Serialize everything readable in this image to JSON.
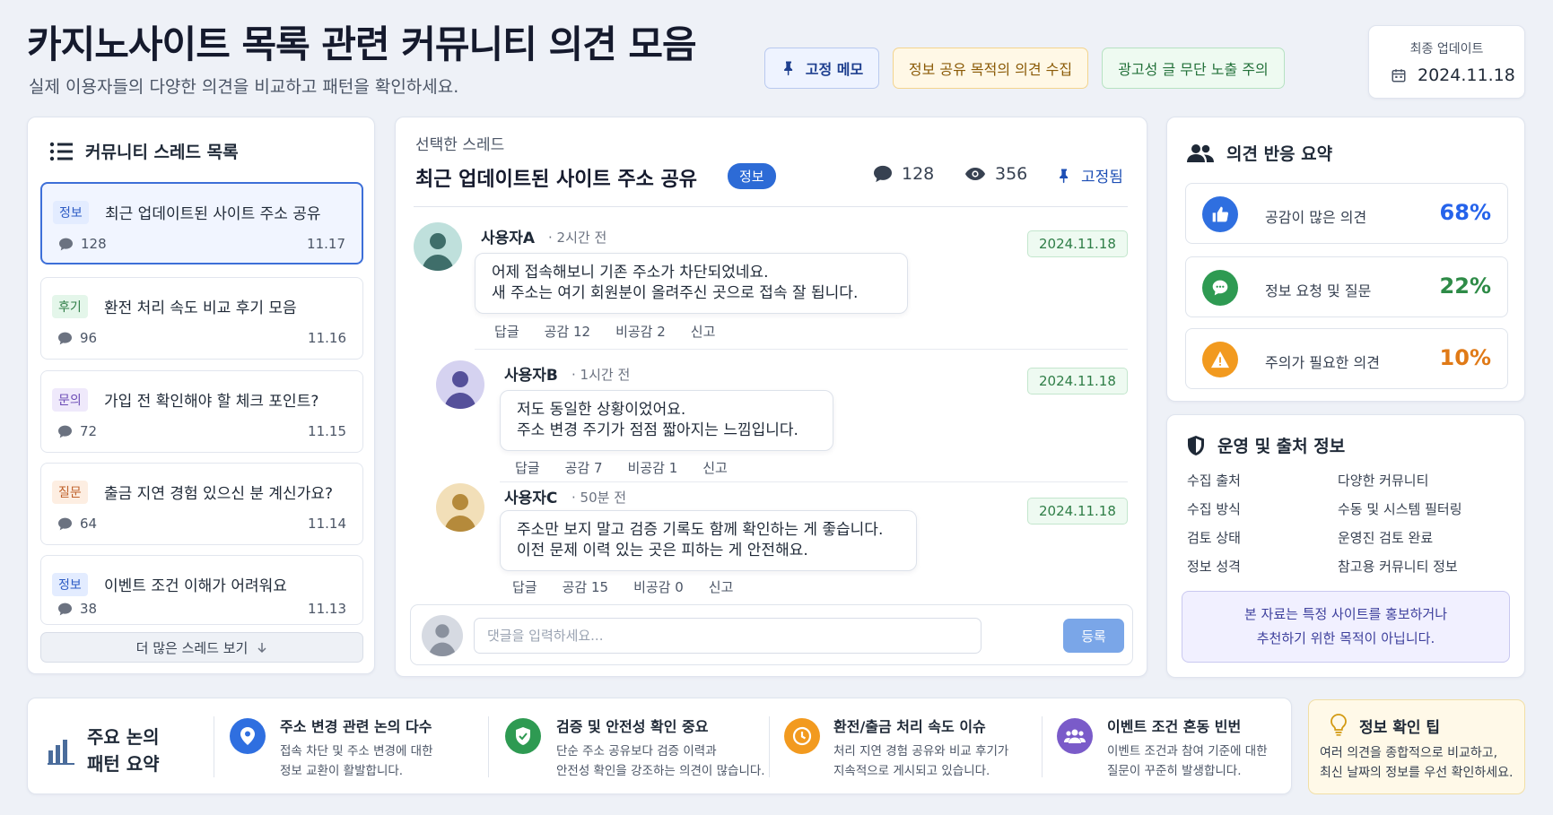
{
  "header": {
    "title": "카지노사이트 목록 관련 커뮤니티 의견 모음",
    "subtitle": "실제 이용자들의 다양한 의견을 비교하고 패턴을 확인하세요.",
    "chips": {
      "pinned_memo": "고정 메모",
      "info_collect": "정보 공유 목적의 의견 수집",
      "ad_warning": "광고성 글 무단 노출 주의"
    },
    "last_update_label": "최종 업데이트",
    "last_update_date": "2024.11.18"
  },
  "threads": {
    "heading": "커뮤니티 스레드 목록",
    "items": [
      {
        "tag": "정보",
        "title": "최근 업데이트된 사이트 주소 공유",
        "count": "128",
        "date": "11.17"
      },
      {
        "tag": "후기",
        "title": "환전 처리 속도 비교 후기 모음",
        "count": "96",
        "date": "11.16"
      },
      {
        "tag": "문의",
        "title": "가입 전 확인해야 할 체크 포인트?",
        "count": "72",
        "date": "11.15"
      },
      {
        "tag": "질문",
        "title": "출금 지연 경험 있으신 분 계신가요?",
        "count": "64",
        "date": "11.14"
      },
      {
        "tag": "정보",
        "title": "이벤트 조건 이해가 어려워요",
        "count": "38",
        "date": "11.13"
      }
    ],
    "more_label": "더 많은 스레드 보기"
  },
  "selected": {
    "label": "선택한 스레드",
    "title": "최근 업데이트된 사이트 주소 공유",
    "badge": "정보",
    "comments_count": "128",
    "views_count": "356",
    "pinned_label": "고정됨"
  },
  "comments": [
    {
      "author": "사용자A",
      "time": "· 2시간 전",
      "date": "2024.11.18",
      "line1": "어제 접속해보니 기존 주소가 차단되었네요.",
      "line2": "새 주소는 여기 회원분이 올려주신 곳으로 접속 잘 됩니다.",
      "reply": "답글",
      "like": "공감 12",
      "dislike": "비공감 2",
      "report": "신고"
    },
    {
      "author": "사용자B",
      "time": "· 1시간 전",
      "date": "2024.11.18",
      "line1": "저도 동일한 상황이었어요.",
      "line2": "주소 변경 주기가 점점 짧아지는 느낌입니다.",
      "reply": "답글",
      "like": "공감 7",
      "dislike": "비공감 1",
      "report": "신고"
    },
    {
      "author": "사용자C",
      "time": "· 50분 전",
      "date": "2024.11.18",
      "line1": "주소만 보지 말고 검증 기록도 함께 확인하는 게 좋습니다.",
      "line2": "이전 문제 이력 있는 곳은 피하는 게 안전해요.",
      "reply": "답글",
      "like": "공감 15",
      "dislike": "비공감 0",
      "report": "신고"
    }
  ],
  "comment_input": {
    "placeholder": "댓글을 입력하세요...",
    "submit_label": "등록"
  },
  "summary": {
    "heading": "의견 반응 요약",
    "items": [
      {
        "label": "공감이 많은 의견",
        "value": "68%",
        "color": "#2563eb"
      },
      {
        "label": "정보 요청 및 질문",
        "value": "22%",
        "color": "#2e8b47"
      },
      {
        "label": "주의가 필요한 의견",
        "value": "10%",
        "color": "#e07a17"
      }
    ]
  },
  "source": {
    "heading": "운영 및 출처 정보",
    "rows": [
      {
        "key": "수집 출처",
        "value": "다양한 커뮤니티"
      },
      {
        "key": "수집 방식",
        "value": "수동 및 시스템 필터링"
      },
      {
        "key": "검토 상태",
        "value": "운영진 검토 완료"
      },
      {
        "key": "정보 성격",
        "value": "참고용 커뮤니티 정보"
      }
    ],
    "notice_line1": "본 자료는 특정 사이트를 홍보하거나",
    "notice_line2": "추천하기 위한 목적이 아닙니다."
  },
  "patterns": {
    "heading_line1": "주요 논의",
    "heading_line2": "패턴 요약",
    "items": [
      {
        "title": "주소 변경 관련 논의 다수",
        "desc1": "접속 차단 및 주소 변경에 대한",
        "desc2": "정보 교환이 활발합니다.",
        "color": "#2f6fe0"
      },
      {
        "title": "검증 및 안전성 확인 중요",
        "desc1": "단순 주소 공유보다 검증 이력과",
        "desc2": "안전성 확인을 강조하는 의견이 많습니다.",
        "color": "#2e9a52"
      },
      {
        "title": "환전/출금 처리 속도 이슈",
        "desc1": "처리 지연 경험 공유와 비교 후기가",
        "desc2": "지속적으로 게시되고 있습니다.",
        "color": "#f29a1f"
      },
      {
        "title": "이벤트 조건 혼동 빈번",
        "desc1": "이벤트 조건과 참여 기준에 대한",
        "desc2": "질문이 꾸준히 발생합니다.",
        "color": "#7a5bc9"
      }
    ]
  },
  "tip": {
    "title": "정보 확인 팁",
    "line1": "여러 의견을 종합적으로 비교하고,",
    "line2": "최신 날짜의 정보를 우선 확인하세요."
  }
}
